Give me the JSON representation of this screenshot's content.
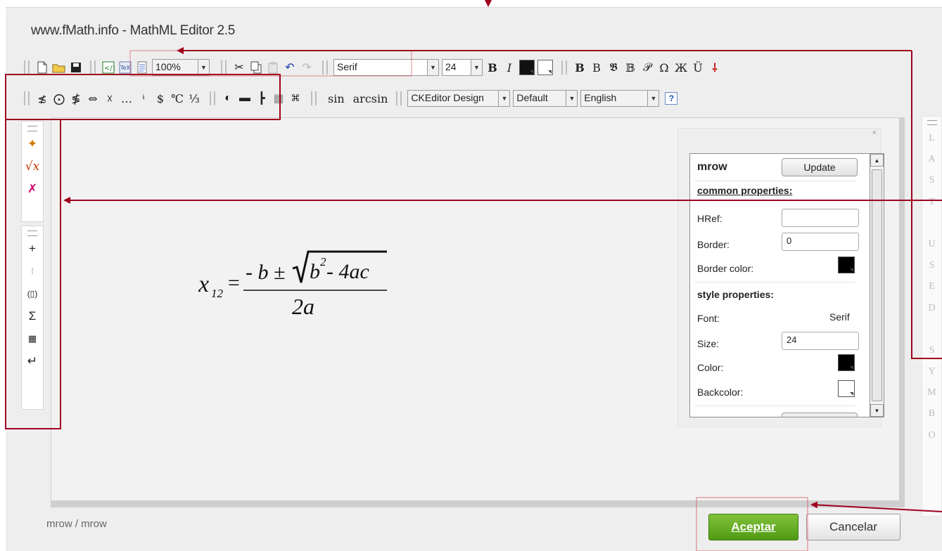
{
  "app": {
    "title": "www.fMath.info - MathML Editor 2.5"
  },
  "toolbar1": {
    "zoom": "100%",
    "font_name": "Serif",
    "font_size": "24",
    "bold": "B",
    "italic": "I",
    "style_glyphs": [
      "B",
      "B",
      "𝕭",
      "𝔹",
      "𝒫",
      "Ω",
      "Ж",
      "Ü"
    ]
  },
  "toolbar2": {
    "symbols": [
      "≴",
      "⨀",
      "≸",
      "⇔",
      "☓",
      "…",
      "ⁱ",
      "$",
      "℃",
      "⅓"
    ],
    "sin_label": "sin",
    "arcsin_label": "arcsin",
    "design_select": "CKEditor Design",
    "style_select": "Default",
    "language_select": "English",
    "help_label": "?"
  },
  "formula": {
    "lhs_var": "x",
    "lhs_sub": "12",
    "equals": "=",
    "numerator_pre": "- b ±",
    "radicand_base": "b",
    "radicand_exp": "2",
    "radicand_rest": " - 4ac",
    "denominator": "2a"
  },
  "properties": {
    "element": "mrow",
    "update_label": "Update",
    "common_heading": "common properties:",
    "href_label": "HRef:",
    "href_value": "",
    "border_label": "Border:",
    "border_value": "0",
    "border_color_label": "Border color:",
    "border_color": "#000000",
    "style_heading": "style properties:",
    "font_label": "Font:",
    "font_value": "Serif",
    "size_label": "Size:",
    "size_value": "24",
    "color_label": "Color:",
    "color_value": "#000000",
    "backcolor_label": "Backcolor:",
    "backcolor_value": "#ffffff",
    "close_label": "×"
  },
  "right_panel": {
    "letters": [
      "L",
      "A",
      "S",
      "T",
      "",
      "U",
      "S",
      "E",
      "D",
      "",
      "S",
      "Y",
      "M",
      "B",
      "O"
    ]
  },
  "status": {
    "path": "mrow / mrow"
  },
  "dialog": {
    "ok_label": "Aceptar",
    "cancel_label": "Cancelar"
  },
  "colors": {
    "annotation": "#a0001e",
    "ok_green": "#5ea91f"
  }
}
